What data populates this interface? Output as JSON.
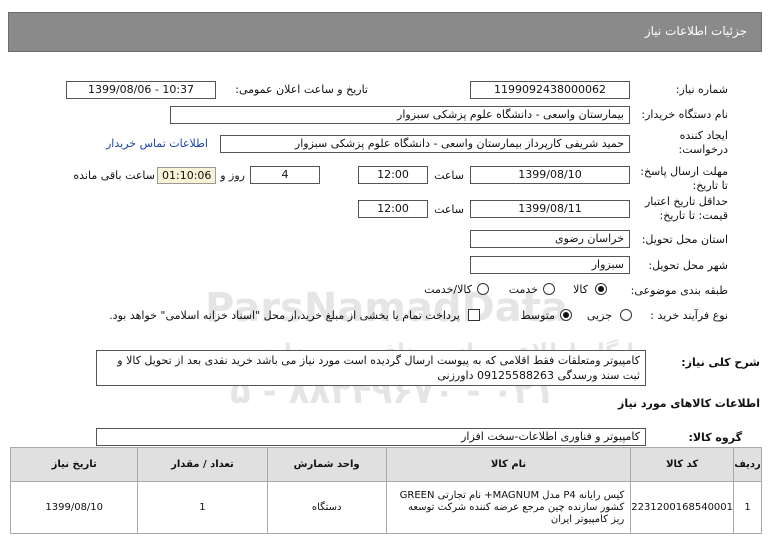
{
  "header": {
    "title": "جزئیات اطلاعات نیاز"
  },
  "fields": {
    "need_number_label": "شماره نیاز:",
    "need_number": "1199092438000062",
    "announce_label": "تاریخ و ساعت اعلان عمومی:",
    "announce_value": "1399/08/06 - 10:37",
    "buyer_label": "نام دستگاه خریدار:",
    "buyer_value": "بیمارستان واسعی - دانشگاه علوم پزشکی سبزوار",
    "creator_label_1": "ایجاد کننده",
    "creator_label_2": "درخواست:",
    "creator_value": "حمید شریفی کارپرداز بیمارستان واسعی - دانشگاه علوم پزشکی سبزوار",
    "contact_link": "اطلاعات تماس خریدار",
    "send_deadline_label_1": "مهلت ارسال پاسخ:",
    "send_deadline_label_2": "تا تاریخ:",
    "send_date": "1399/08/10",
    "time_label": "ساعت",
    "send_time": "12:00",
    "days_value": "4",
    "days_label": "روز و",
    "remaining_time": "01:10:06",
    "remaining_label": "ساعت باقی مانده",
    "validity_label_1": "حداقل تاریخ اعتبار",
    "validity_label_2": "قیمت: تا تاریخ:",
    "validity_date": "1399/08/11",
    "validity_time_label": "ساعت",
    "validity_time": "12:00",
    "province_label": "استان محل تحویل:",
    "province_value": "خراسان رضوی",
    "city_label": "شهر محل تحویل:",
    "city_value": "سبزوار",
    "category_label": "طبقه بندی موضوعی:",
    "category_options": [
      "کالا",
      "خدمت",
      "کالا/خدمت"
    ],
    "process_label": "نوع فرآیند خرید :",
    "process_options": [
      "جزیی",
      "متوسط"
    ],
    "payment_note": "پرداخت تمام یا بخشی از مبلغ خرید،از محل \"اسناد خزانه اسلامی\" خواهد بود."
  },
  "description": {
    "label": "شرح کلی نیاز:",
    "text": "کامپیوتر ومتعلقات فقط اقلامی که به پیوست ارسال گردیده است مورد نیاز می باشد خرید نقدی بعد از  تحویل کالا و ثبت سند ورسدگی  09125588263 داورزنی"
  },
  "goods_section": {
    "title": "اطلاعات کالاهای مورد نیاز",
    "group_label": "گروه کالا:",
    "group_value": "کامپیوتر و فناوری اطلاعات-سخت افزار"
  },
  "table": {
    "headers": [
      "ردیف",
      "کد کالا",
      "نام کالا",
      "واحد شمارش",
      "تعداد / مقدار",
      "تاریخ نیاز"
    ],
    "rows": [
      {
        "row": "1",
        "code": "2231200168540001",
        "name": "کیس رایانه P4 مدل MAGNUM+ نام تجارتی GREEN کشور سازنده چین مرجع عرضه کننده شرکت توسعه ریز کامپیوتر ایران",
        "unit": "دستگاه",
        "qty": "1",
        "date": "1399/08/10"
      }
    ]
  },
  "watermark": {
    "line1": "ParsNamadData",
    "line2": "پایگاه اطلاع رسانی مناقصه و مزایده",
    "line3": "۰۲۱ - ۸۸۳۴۹۶۷۰ - ۵"
  }
}
